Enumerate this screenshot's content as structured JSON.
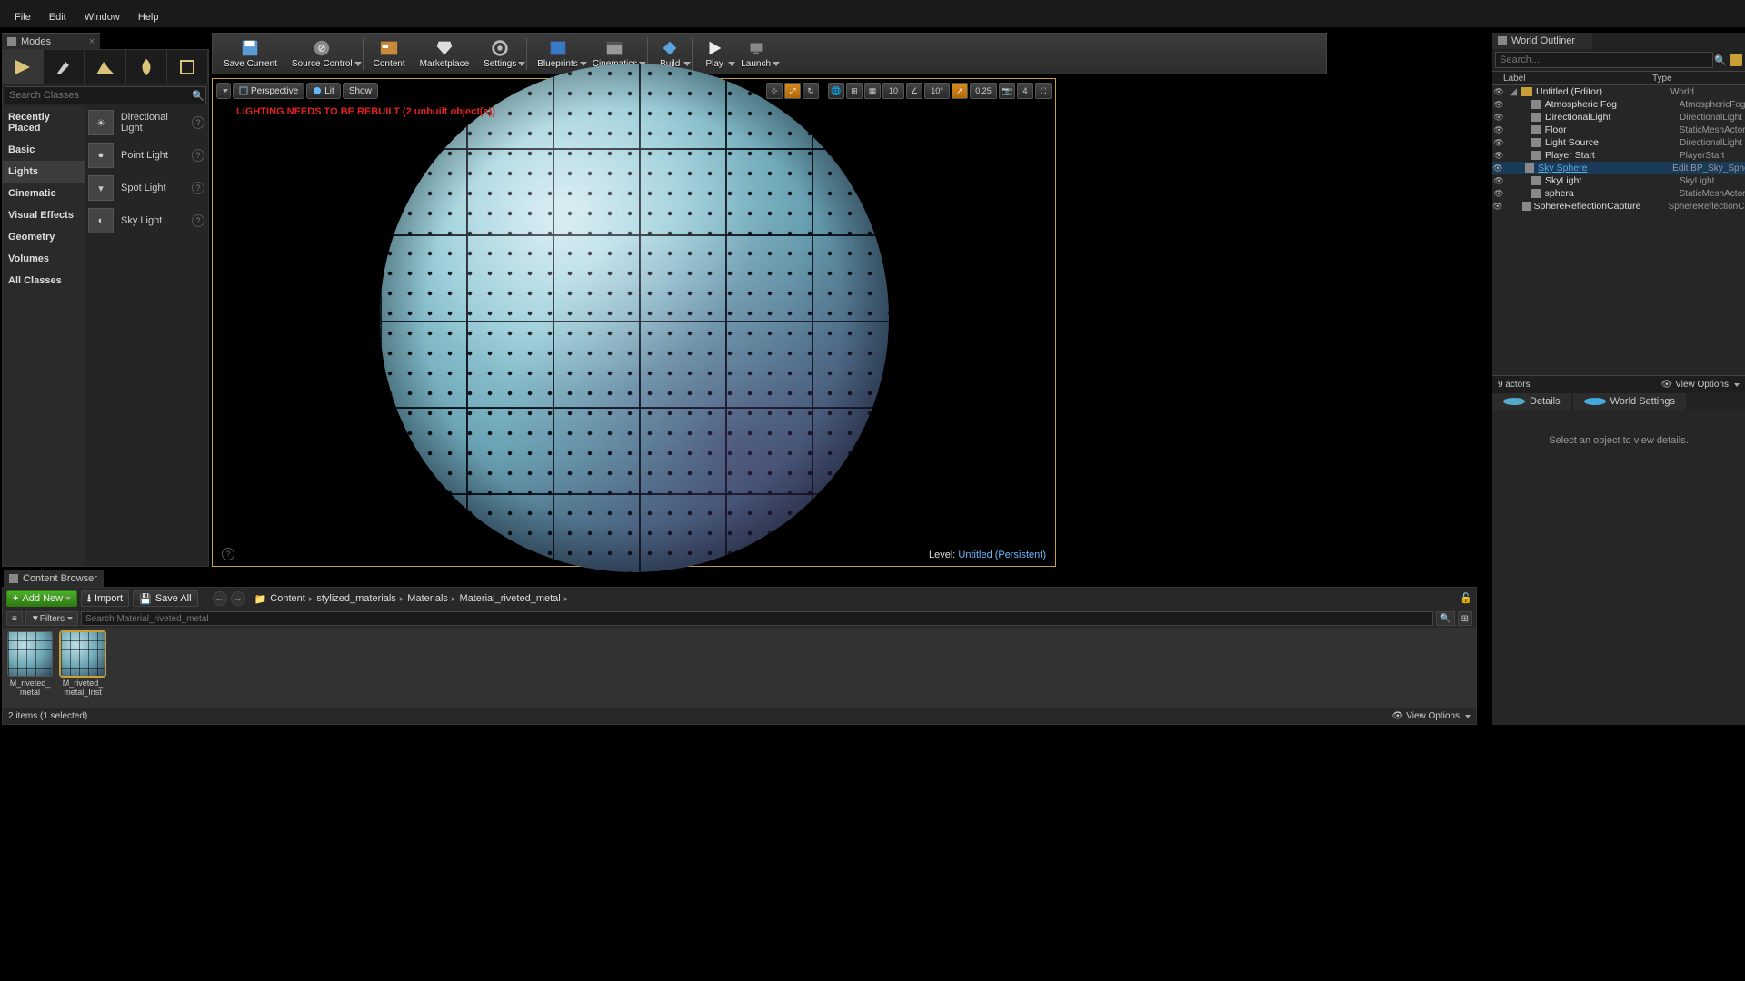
{
  "menu": [
    "File",
    "Edit",
    "Window",
    "Help"
  ],
  "panels": {
    "modes": "Modes",
    "outliner": "World Outliner",
    "details": "Details",
    "world_settings": "World Settings",
    "content_browser": "Content Browser"
  },
  "modes_panel": {
    "search_placeholder": "Search Classes",
    "categories": [
      "Recently Placed",
      "Basic",
      "Lights",
      "Cinematic",
      "Visual Effects",
      "Geometry",
      "Volumes",
      "All Classes"
    ],
    "selected_category": "Lights",
    "lights": [
      "Directional Light",
      "Point Light",
      "Spot Light",
      "Sky Light"
    ]
  },
  "toolbar": {
    "save_current": "Save Current",
    "source_control": "Source Control",
    "content": "Content",
    "marketplace": "Marketplace",
    "settings": "Settings",
    "blueprints": "Blueprints",
    "cinematics": "Cinematics",
    "build": "Build",
    "play": "Play",
    "launch": "Launch"
  },
  "viewport": {
    "perspective": "Perspective",
    "lit": "Lit",
    "show": "Show",
    "warning": "LIGHTING NEEDS TO BE REBUILT (2 unbuilt object(s))",
    "snap1": "10",
    "snap2": "10°",
    "snap3": "0.25",
    "cam": "4",
    "level_label": "Level:",
    "level_name": "Untitled (Persistent)"
  },
  "outliner": {
    "search_placeholder": "Search...",
    "col_label": "Label",
    "col_type": "Type",
    "rows": [
      {
        "label": "Untitled (Editor)",
        "type": "World",
        "indent": 0
      },
      {
        "label": "Atmospheric Fog",
        "type": "AtmosphericFog",
        "indent": 1
      },
      {
        "label": "DirectionalLight",
        "type": "DirectionalLight",
        "indent": 1
      },
      {
        "label": "Floor",
        "type": "StaticMeshActor",
        "indent": 1
      },
      {
        "label": "Light Source",
        "type": "DirectionalLight",
        "indent": 1
      },
      {
        "label": "Player Start",
        "type": "PlayerStart",
        "indent": 1
      },
      {
        "label": "Sky Sphere",
        "type": "Edit BP_Sky_Sphere",
        "indent": 1,
        "link": true
      },
      {
        "label": "SkyLight",
        "type": "SkyLight",
        "indent": 1
      },
      {
        "label": "sphera",
        "type": "StaticMeshActor",
        "indent": 1
      },
      {
        "label": "SphereReflectionCapture",
        "type": "SphereReflectionCapture",
        "indent": 1
      }
    ],
    "footer": "9 actors",
    "view_options": "View Options"
  },
  "details": {
    "empty": "Select an object to view details."
  },
  "content_browser": {
    "add_new": "Add New",
    "import": "Import",
    "save_all": "Save All",
    "path": [
      "Content",
      "stylized_materials",
      "Materials",
      "Material_riveted_metal"
    ],
    "filters": "Filters",
    "search_placeholder": "Search Material_riveted_metal",
    "assets": [
      {
        "name": "M_riveted_metal"
      },
      {
        "name": "M_riveted_metal_Inst",
        "sel": true
      }
    ],
    "status": "2 items (1 selected)",
    "view_options": "View Options"
  }
}
